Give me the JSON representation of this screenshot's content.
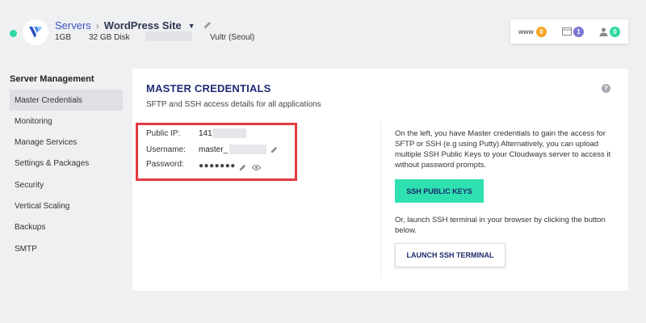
{
  "header": {
    "breadcrumb_root": "Servers",
    "breadcrumb_separator": "›",
    "breadcrumb_current": "WordPress Site",
    "meta": {
      "ram": "1GB",
      "disk": "32 GB Disk",
      "provider": "Vultr (Seoul)"
    },
    "counters": [
      {
        "label": "www",
        "count": "0",
        "color": "#f5a524"
      },
      {
        "label": "",
        "count": "1",
        "color": "#7a78d6"
      },
      {
        "label": "",
        "count": "0",
        "color": "#2fd8a5"
      }
    ],
    "status_color": "#2fd8a5"
  },
  "sidebar": {
    "title": "Server Management",
    "items": [
      {
        "label": "Master Credentials",
        "active": true
      },
      {
        "label": "Monitoring"
      },
      {
        "label": "Manage Services"
      },
      {
        "label": "Settings & Packages"
      },
      {
        "label": "Security"
      },
      {
        "label": "Vertical Scaling"
      },
      {
        "label": "Backups"
      },
      {
        "label": "SMTP"
      }
    ]
  },
  "card": {
    "title": "MASTER CREDENTIALS",
    "subtitle": "SFTP and SSH access details for all applications",
    "help_icon": "?",
    "credentials": {
      "public_ip_label": "Public IP:",
      "public_ip_value": "141",
      "username_label": "Username:",
      "username_value": "master_",
      "password_label": "Password:",
      "password_value": "●●●●●●●"
    },
    "info_text": "On the left, you have Master credentials to gain the access for SFTP or SSH (e.g using Putty) Alternatively, you can upload multiple SSH Public Keys to your Cloudways server to access it without password prompts.",
    "ssh_keys_button": "SSH PUBLIC KEYS",
    "terminal_text": "Or, launch SSH terminal in your browser by clicking the button below.",
    "terminal_button": "LAUNCH SSH TERMINAL",
    "highlight_color": "#e53a40"
  }
}
